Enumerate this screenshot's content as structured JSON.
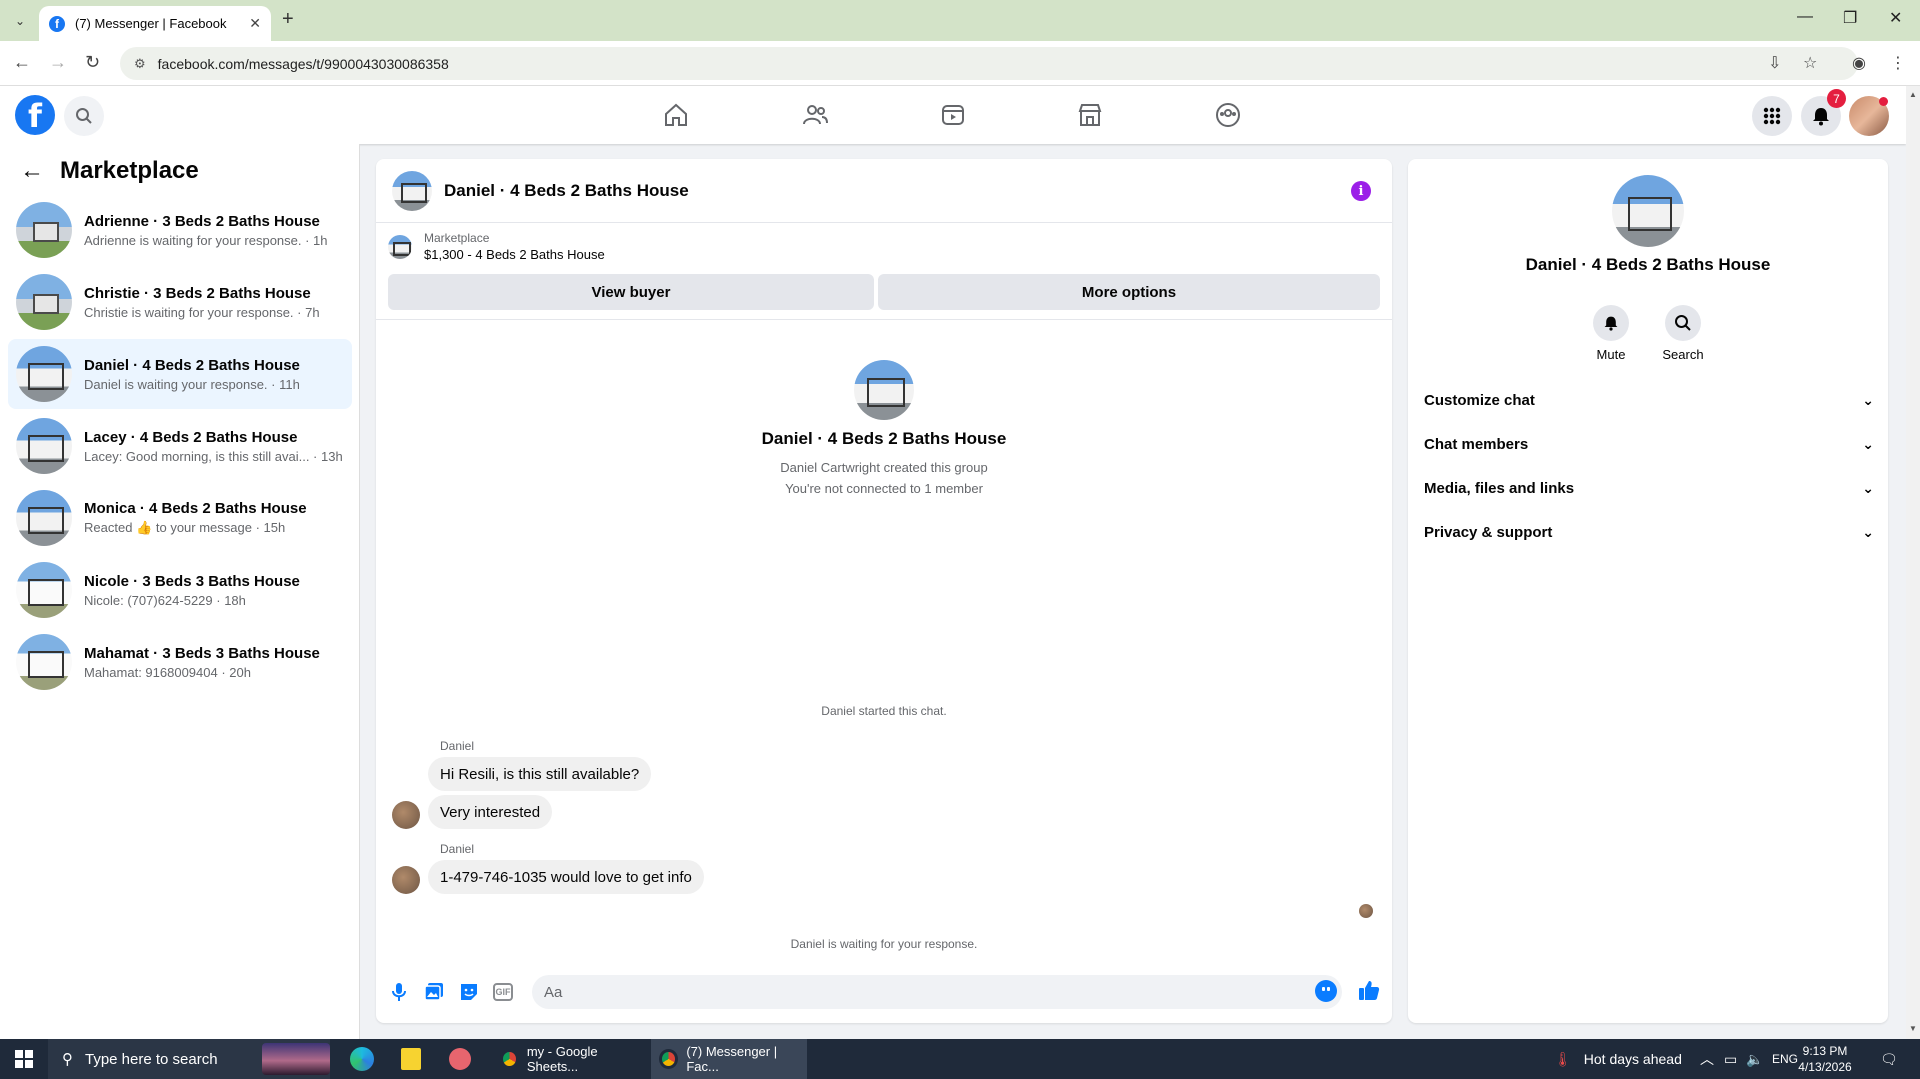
{
  "browser": {
    "tab_title": "(7) Messenger | Facebook",
    "url": "facebook.com/messages/t/9900043030086358"
  },
  "header": {
    "notification_count": "7",
    "nav_icons": [
      "home-icon",
      "friends-icon",
      "video-icon",
      "marketplace-icon",
      "groups-icon"
    ]
  },
  "sidebar": {
    "title": "Marketplace",
    "conversations": [
      {
        "name": "Adrienne · 3 Beds 2 Baths House",
        "snippet": "Adrienne is waiting for your response. · 1h",
        "active": false
      },
      {
        "name": "Christie · 3 Beds 2 Baths House",
        "snippet": "Christie is waiting for your response. · 7h",
        "active": false
      },
      {
        "name": "Daniel · 4 Beds 2 Baths House",
        "snippet": "Daniel is waiting your response. · 11h",
        "active": true
      },
      {
        "name": "Lacey · 4 Beds 2 Baths House",
        "snippet": "Lacey: Good morning, is this still avai... · 13h",
        "active": false
      },
      {
        "name": "Monica · 4 Beds 2 Baths House",
        "snippet_pre": "Reacted",
        "snippet_post": "to your message · 15h",
        "active": false
      },
      {
        "name": "Nicole · 3 Beds 3 Baths House",
        "snippet": "Nicole: (707)624-5229 · 18h",
        "active": false
      },
      {
        "name": "Mahamat · 3 Beds 3 Baths House",
        "snippet": "Mahamat: 9168009404 · 20h",
        "active": false
      }
    ]
  },
  "chat": {
    "title": "Daniel · 4 Beds 2 Baths House",
    "listing_label": "Marketplace",
    "listing_value": "$1,300 - 4 Beds 2 Baths House",
    "view_buyer": "View buyer",
    "more_options": "More options",
    "intro_title": "Daniel · 4 Beds 2 Baths House",
    "intro_created": "Daniel Cartwright created this group",
    "intro_connected": "You're not connected to 1 member",
    "started": "Daniel started this chat.",
    "sender1": "Daniel",
    "msg1": "Hi Resili, is this still available?",
    "msg2": "Very interested",
    "sender2": "Daniel",
    "msg3": "1-479-746-1035  would love to get info",
    "waiting": "Daniel is waiting for your response.",
    "input_placeholder": "Aa"
  },
  "details": {
    "name": "Daniel · 4 Beds 2 Baths House",
    "mute": "Mute",
    "search": "Search",
    "sections": [
      "Customize chat",
      "Chat members",
      "Media, files and links",
      "Privacy & support"
    ]
  },
  "taskbar": {
    "search_placeholder": "Type here to search",
    "win_sheets": "my - Google Sheets...",
    "win_messenger": "(7) Messenger | Fac...",
    "weather": "Hot days ahead",
    "lang": "ENG",
    "time": "9:13 PM",
    "date": "4/13/2026"
  },
  "colors": {
    "fb_blue": "#1877f2",
    "active_row": "#ebf5ff",
    "info_purple": "#9b1fe8",
    "badge_red": "#e41e3f"
  }
}
